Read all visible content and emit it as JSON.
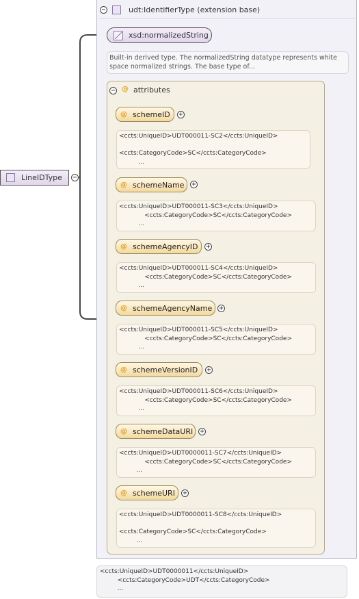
{
  "root": {
    "label": "LineIDType"
  },
  "extension": {
    "label": "udt:IdentifierType (extension base)"
  },
  "base_type": {
    "label": "xsd:normalizedString"
  },
  "base_doc": "Built-in derived type. The normalizedString datatype represents white\nspace normalized strings. The base type of...",
  "attributes_group": {
    "label": "attributes"
  },
  "attributes": [
    {
      "name": "schemeID",
      "doc": "<ccts:UniqueID>UDT000011-SC2</ccts:UniqueID>\n\n<ccts:CategoryCode>SC</ccts:CategoryCode>\n          ..."
    },
    {
      "name": "schemeName",
      "doc": "<ccts:UniqueID>UDT000011-SC3</ccts:UniqueID>\n             <ccts:CategoryCode>SC</ccts:CategoryCode>\n          ..."
    },
    {
      "name": "schemeAgencyID",
      "doc": "<ccts:UniqueID>UDT000011-SC4</ccts:UniqueID>\n             <ccts:CategoryCode>SC</ccts:CategoryCode>\n          ..."
    },
    {
      "name": "schemeAgencyName",
      "doc": "<ccts:UniqueID>UDT000011-SC5</ccts:UniqueID>\n             <ccts:CategoryCode>SC</ccts:CategoryCode>\n          ..."
    },
    {
      "name": "schemeVersionID",
      "doc": "<ccts:UniqueID>UDT000011-SC6</ccts:UniqueID>\n             <ccts:CategoryCode>SC</ccts:CategoryCode>\n          ..."
    },
    {
      "name": "schemeDataURI",
      "doc": "<ccts:UniqueID>UDT0000011-SC7</ccts:UniqueID>\n             <ccts:CategoryCode>SC</ccts:CategoryCode>\n         ..."
    },
    {
      "name": "schemeURI",
      "doc": "<ccts:UniqueID>UDT0000011-SC8</ccts:UniqueID>\n\n<ccts:CategoryCode>SC</ccts:CategoryCode>\n         ..."
    }
  ],
  "bottom_doc": "<ccts:UniqueID>UDT0000011</ccts:UniqueID>\n         <ccts:CategoryCode>UDT</ccts:CategoryCode>\n         ...",
  "icons": {
    "collapse": "minus-circle",
    "expand": "plus-circle",
    "attribute": "at-sign"
  },
  "colors": {
    "attribute_accent": "#e0a020",
    "complex_type": "#ece4f4"
  }
}
